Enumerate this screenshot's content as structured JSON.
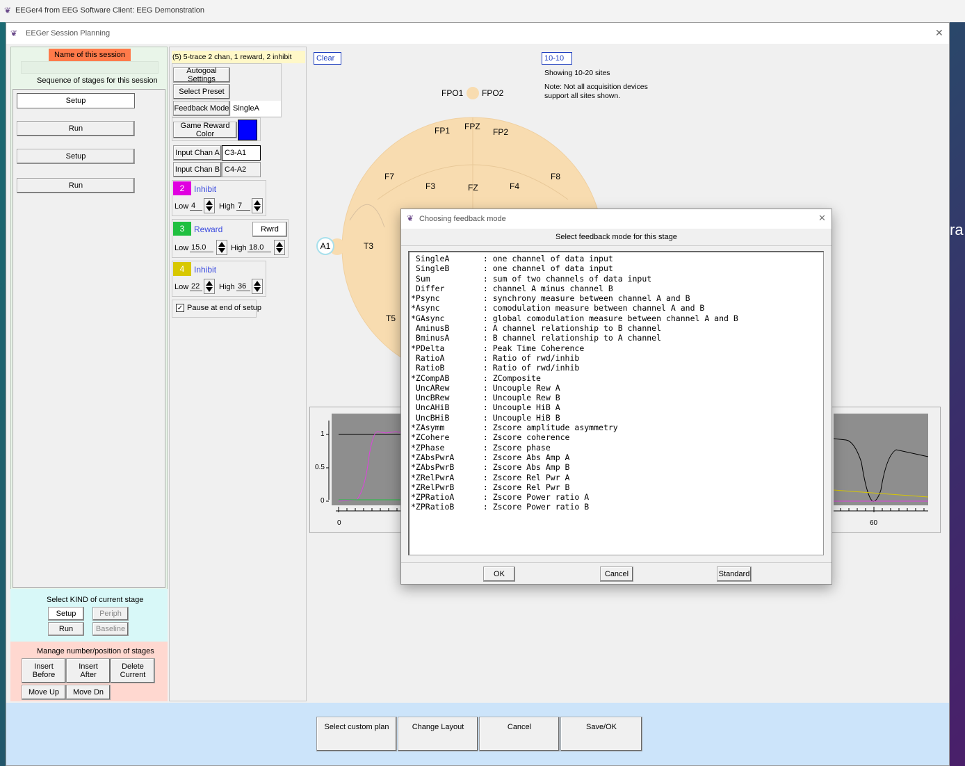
{
  "outer_title": "EEGer4 from EEG Software  Client: EEG Demonstration",
  "window_title": "EEGer Session Planning",
  "left": {
    "plan_name_label": "Name of this session plan",
    "sequence_label": "Sequence of stages for this session",
    "stages": [
      "Setup",
      "Run",
      "Setup",
      "Run"
    ],
    "kind_label": "Select KIND of current stage",
    "kind_buttons": [
      "Setup",
      "Periph",
      "Run",
      "Baseline"
    ],
    "manage_label": "Manage number/position of stages",
    "insert_before": "Insert\nBefore",
    "insert_after": "Insert\nAfter",
    "delete_current": "Delete\nCurrent",
    "move_up": "Move Up",
    "move_dn": "Move Dn"
  },
  "mid": {
    "preset_title": "(5) 5-trace 2 chan, 1 reward, 2 inhibit",
    "autogoal": "Autogoal Settings",
    "select_preset": "Select Preset",
    "feedback_mode_label": "Feedback Mode",
    "feedback_mode_value": "SingleA",
    "game_reward_color": "Game Reward Color",
    "game_reward_color_hex": "#0000ff",
    "input_a_label": "Input Chan A",
    "input_a_value": "C3-A1",
    "input_b_label": "Input Chan B",
    "input_b_value": "C4-A2",
    "bands": [
      {
        "num": "2",
        "name": "Inhibit",
        "color": "#e000e0",
        "low_label": "Low",
        "low": "4",
        "high_label": "High",
        "high": "7"
      },
      {
        "num": "3",
        "name": "Reward",
        "color": "#20c040",
        "low_label": "Low",
        "low": "15.0",
        "high_label": "High",
        "high": "18.0",
        "extra": "Rwrd"
      },
      {
        "num": "4",
        "name": "Inhibit",
        "color": "#d8c800",
        "low_label": "Low",
        "low": "22",
        "high_label": "High",
        "high": "36"
      }
    ],
    "pause_label": "Pause at end of setup",
    "pause_checked": "✓"
  },
  "montage": {
    "clear": "Clear",
    "system": "10-10",
    "showing": "Showing 10-20 sites",
    "note1": "Note: Not all acquisition devices",
    "note2": "support all sites shown.",
    "sites": {
      "FPO1": "FPO1",
      "FPO2": "FPO2",
      "FP1": "FP1",
      "FPZ": "FPZ",
      "FP2": "FP2",
      "F7": "F7",
      "F3": "F3",
      "FZ": "FZ",
      "F4": "F4",
      "F8": "F8",
      "A1": "A1",
      "T3": "T3",
      "T5": "T5"
    }
  },
  "graph": {
    "y_ticks": [
      "1",
      "0.5",
      "0"
    ],
    "x_left_tick": "0",
    "x_right_tick": "60"
  },
  "dialog": {
    "title": "Choosing feedback mode",
    "subtitle": "Select feedback mode for this stage",
    "modes": [
      " SingleA       : one channel of data input",
      " SingleB       : one channel of data input",
      " Sum           : sum of two channels of data input",
      " Differ        : channel A minus channel B",
      "*Psync         : synchrony measure between channel A and B",
      "*Async         : comodulation measure between channel A and B",
      "*GAsync        : global comodulation measure between channel A and B",
      " AminusB       : A channel relationship to B channel",
      " BminusA       : B channel relationship to A channel",
      "*PDelta        : Peak Time Coherence",
      " RatioA        : Ratio of rwd/inhib",
      " RatioB        : Ratio of rwd/inhib",
      "*ZCompAB       : ZComposite",
      " UncARew       : Uncouple Rew A",
      " UncBRew       : Uncouple Rew B",
      " UncAHiB       : Uncouple HiB A",
      " UncBHiB       : Uncouple HiB B",
      "*ZAsymm        : Zscore amplitude asymmetry",
      "*ZCohere       : Zscore coherence",
      "*ZPhase        : Zscore phase",
      "*ZAbsPwrA      : Zscore Abs Amp A",
      "*ZAbsPwrB      : Zscore Abs Amp B",
      "*ZRelPwrA      : Zscore Rel Pwr A",
      "*ZRelPwrB      : Zscore Rel Pwr B",
      "*ZPRatioA      : Zscore Power ratio A",
      "*ZPRatioB      : Zscore Power ratio B"
    ],
    "ok": "OK",
    "cancel": "Cancel",
    "standard": "Standard"
  },
  "bottom": {
    "select_custom": "Select custom plan",
    "change_layout": "Change Layout",
    "cancel": "Cancel",
    "save_ok": "Save/OK"
  },
  "desktop_fragment": "ra"
}
